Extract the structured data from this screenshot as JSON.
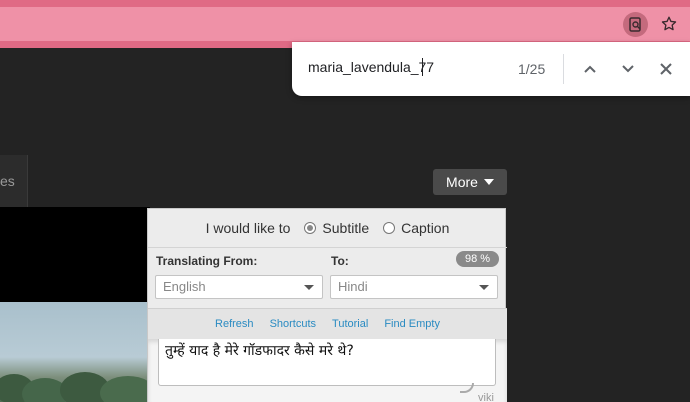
{
  "browser": {
    "extension_icon": "magnifier-page-icon",
    "bookmark_icon": "star-icon"
  },
  "findbar": {
    "query": "maria_lavendula_77",
    "count": "1/25",
    "prev_icon": "chevron-up-icon",
    "next_icon": "chevron-down-icon",
    "close_icon": "close-icon"
  },
  "page": {
    "tab_partial": "es",
    "more_label": "More"
  },
  "panel": {
    "prompt": "I would like to",
    "modes": [
      {
        "label": "Subtitle",
        "selected": true
      },
      {
        "label": "Caption",
        "selected": false
      }
    ],
    "from_label": "Translating From:",
    "to_label": "To:",
    "progress": "98 %",
    "from_value": "English",
    "to_value": "Hindi",
    "links": [
      "Refresh",
      "Shortcuts",
      "Tutorial",
      "Find Empty"
    ],
    "subtitle_text": "तुम्हें याद है मेरे गॉडफादर कैसे मरे थे?",
    "brand": "viki"
  }
}
